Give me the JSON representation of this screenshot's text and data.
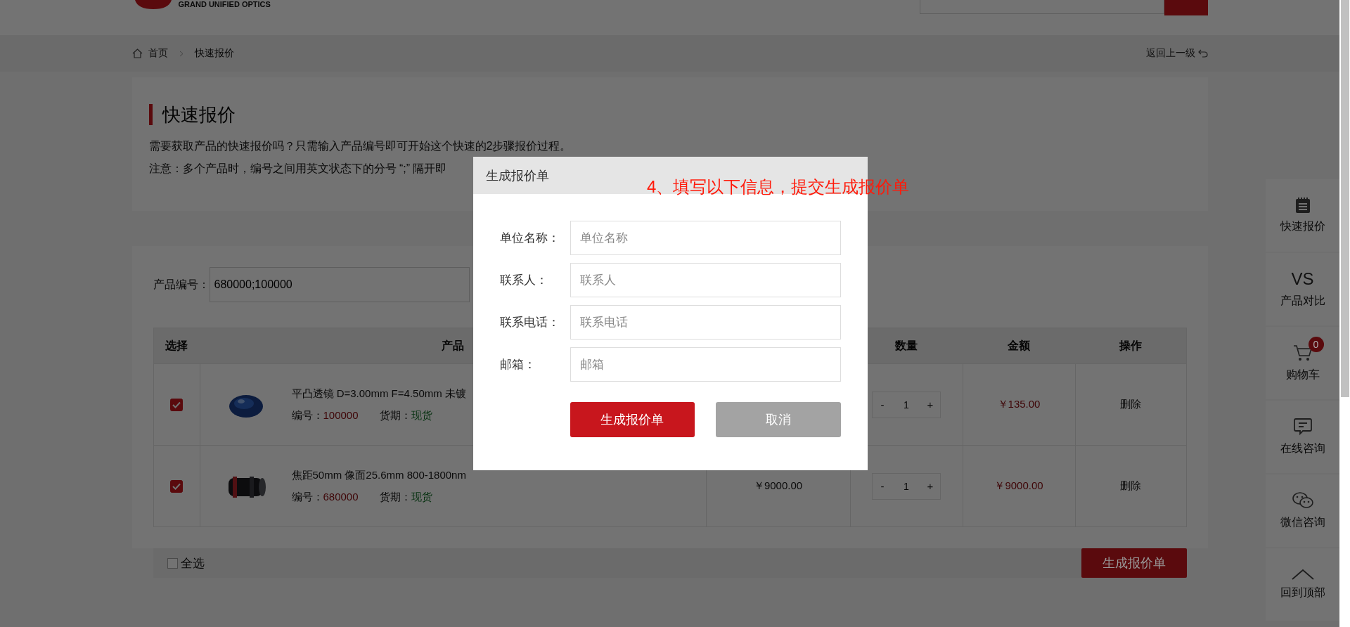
{
  "header": {
    "logo_text": "GRAND UNIFIED OPTICS"
  },
  "breadcrumb": {
    "items": [
      "首页",
      "快速报价"
    ],
    "back": "返回上一级"
  },
  "intro": {
    "title": "快速报价",
    "lines": [
      "需要获取产品的快速报价吗？只需输入产品编号即可开始这个快速的2步骤报价过程。",
      "注意：多个产品时，编号之间用英文状态下的分号 “;” 隔开即"
    ]
  },
  "product_field": {
    "label": "产品编号：",
    "value": "680000;100000"
  },
  "table": {
    "columns": [
      "选择",
      "产品",
      "数量",
      "金额",
      "操作"
    ],
    "rows": [
      {
        "checked": true,
        "name": "平凸透镜 D=3.00mm F=4.50mm 未镀",
        "code_label": "编号：",
        "code": "100000",
        "delivery_label": "货期：",
        "delivery": "现货",
        "qty": "1",
        "amount": "￥135.00",
        "action": "删除",
        "minus": "-",
        "plus": "+"
      },
      {
        "checked": true,
        "name": "焦距50mm 像面25.6mm 800-1800nm",
        "code_label": "编号：",
        "code": "680000",
        "delivery_label": "货期：",
        "delivery": "现货",
        "price": "￥9000.00",
        "qty": "1",
        "amount": "￥9000.00",
        "action": "删除",
        "minus": "-",
        "plus": "+"
      }
    ]
  },
  "footer": {
    "select_all": {
      "label": "全选",
      "checked": false
    },
    "button": "生成报价单"
  },
  "sidebar": [
    {
      "kind": "notepad",
      "label": "快速报价"
    },
    {
      "kind": "vs",
      "icon_text": "VS",
      "label": "产品对比"
    },
    {
      "kind": "cart",
      "label": "购物车",
      "badge": "0"
    },
    {
      "kind": "chat",
      "label": "在线咨询"
    },
    {
      "kind": "wechat",
      "label": "微信咨询"
    },
    {
      "kind": "top",
      "label": "回到顶部"
    }
  ],
  "dialog": {
    "title": "生成报价单",
    "fields": [
      {
        "label": "单位名称：",
        "placeholder": "单位名称"
      },
      {
        "label": "联系人：",
        "placeholder": "联系人"
      },
      {
        "label": "联系电话：",
        "placeholder": "联系电话"
      },
      {
        "label": "邮箱：",
        "placeholder": "邮箱"
      }
    ],
    "submit": "生成报价单",
    "cancel": "取消"
  },
  "annotation": "4、填写以下信息，提交生成报价单"
}
